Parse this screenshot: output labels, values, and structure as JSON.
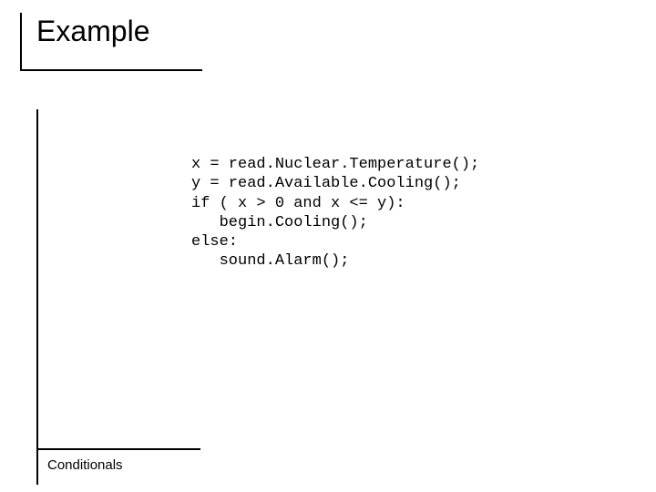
{
  "title": "Example",
  "code": "x = read.Nuclear.Temperature();\ny = read.Available.Cooling();\nif ( x > 0 and x <= y):\n   begin.Cooling();\nelse:\n   sound.Alarm();",
  "footer": "Conditionals"
}
